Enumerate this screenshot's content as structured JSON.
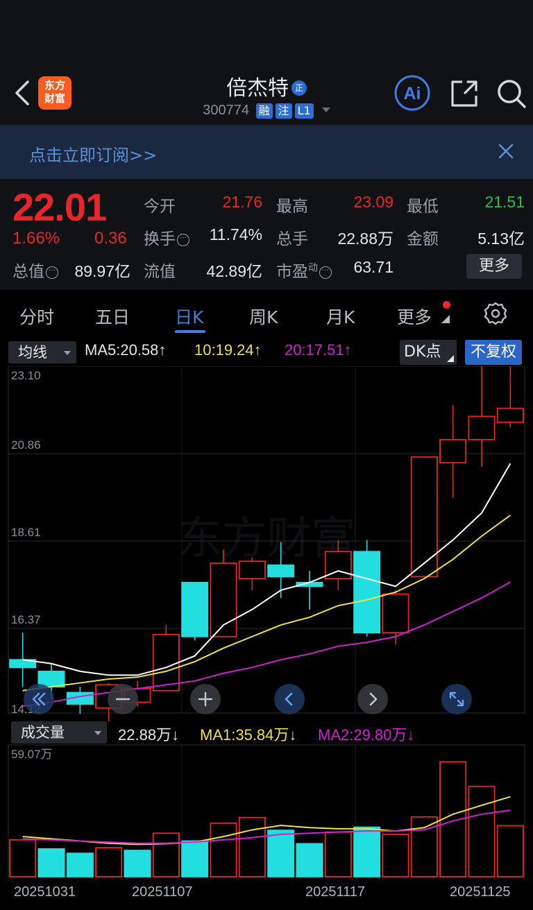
{
  "header": {
    "logo_line1": "东方",
    "logo_line2": "财富",
    "stock_name": "倍杰特",
    "zheng_badge": "正",
    "stock_code": "300774",
    "tags": [
      "融",
      "注",
      "L1"
    ],
    "ai_label": "Ai"
  },
  "banner": {
    "text": "点击立即订阅>>"
  },
  "quote": {
    "price": "22.01",
    "change_pct": "1.66%",
    "change_abs": "0.36",
    "fields": {
      "open_label": "今开",
      "open_value": "21.76",
      "high_label": "最高",
      "high_value": "23.09",
      "low_label": "最低",
      "low_value": "21.51",
      "turnover_label": "换手",
      "turnover_value": "11.74%",
      "volume_label": "总手",
      "volume_value": "22.88万",
      "amount_label": "金额",
      "amount_value": "5.13亿",
      "mktcap_label": "总值",
      "mktcap_value": "89.97亿",
      "float_label": "流值",
      "float_value": "42.89亿",
      "pe_label": "市盈",
      "pe_sup": "动",
      "pe_value": "63.71"
    },
    "more_label": "更多"
  },
  "tabs": [
    {
      "label": "分时",
      "active": false
    },
    {
      "label": "五日",
      "active": false
    },
    {
      "label": "日K",
      "active": true
    },
    {
      "label": "周K",
      "active": false
    },
    {
      "label": "月K",
      "active": false
    },
    {
      "label": "更多",
      "active": false
    }
  ],
  "ma_bar": {
    "selector": "均线",
    "ma5": "MA5:20.58↑",
    "ma10": "10:19.24↑",
    "ma20": "20:17.51↑",
    "dk_label": "DK点",
    "fq_label": "不复权"
  },
  "volume_bar": {
    "selector": "成交量",
    "vol": "22.88万↓",
    "ma1": "MA1:35.84万↓",
    "ma2": "MA2:29.80万↓"
  },
  "colors": {
    "up": "#e8262a",
    "down": "#22dede",
    "ma5": "#ffffff",
    "ma10": "#f0e040",
    "ma20": "#d020d0",
    "accent": "#3d7fe6"
  },
  "chart_data": {
    "type": "candlestick",
    "price_ticks": [
      "23.10",
      "20.86",
      "18.61",
      "16.37",
      "14.12"
    ],
    "ylim": [
      14.12,
      23.1
    ],
    "volume_max_label": "59.07万",
    "date_labels": [
      "20251031",
      "20251107",
      "20251117",
      "20251125"
    ],
    "candles": [
      {
        "o": 15.5,
        "c": 15.3,
        "h": 16.2,
        "l": 14.8
      },
      {
        "o": 15.2,
        "c": 14.8,
        "h": 15.4,
        "l": 14.5
      },
      {
        "o": 14.65,
        "c": 14.35,
        "h": 14.8,
        "l": 14.1
      },
      {
        "o": 14.25,
        "c": 14.85,
        "h": 14.9,
        "l": 13.9
      },
      {
        "o": 14.4,
        "c": 14.75,
        "h": 14.95,
        "l": 14.3
      },
      {
        "o": 14.7,
        "c": 16.15,
        "h": 16.4,
        "l": 14.7
      },
      {
        "o": 17.5,
        "c": 16.1,
        "h": 17.5,
        "l": 16.0
      },
      {
        "o": 16.1,
        "c": 18.0,
        "h": 18.35,
        "l": 16.1
      },
      {
        "o": 17.6,
        "c": 18.05,
        "h": 18.15,
        "l": 17.3
      },
      {
        "o": 17.95,
        "c": 17.65,
        "h": 18.55,
        "l": 17.1
      },
      {
        "o": 17.5,
        "c": 17.4,
        "h": 17.8,
        "l": 16.8
      },
      {
        "o": 17.6,
        "c": 18.3,
        "h": 18.6,
        "l": 17.3
      },
      {
        "o": 18.3,
        "c": 16.2,
        "h": 18.6,
        "l": 16.1
      },
      {
        "o": 16.2,
        "c": 17.2,
        "h": 17.3,
        "l": 15.9
      },
      {
        "o": 17.65,
        "c": 20.75,
        "h": 20.75,
        "l": 17.65
      },
      {
        "o": 20.6,
        "c": 21.2,
        "h": 22.1,
        "l": 19.7
      },
      {
        "o": 21.2,
        "c": 21.8,
        "h": 23.1,
        "l": 20.5
      },
      {
        "o": 21.65,
        "c": 22.01,
        "h": 23.09,
        "l": 21.51
      }
    ],
    "ma5": [
      15.5,
      15.4,
      15.2,
      15.1,
      15.1,
      15.3,
      15.6,
      16.4,
      16.8,
      17.3,
      17.5,
      17.8,
      17.6,
      17.4,
      18.0,
      18.6,
      19.3,
      20.58
    ],
    "ma10": [
      14.7,
      14.8,
      14.9,
      15.0,
      15.05,
      15.2,
      15.45,
      15.8,
      16.1,
      16.4,
      16.6,
      16.9,
      17.05,
      17.25,
      17.6,
      18.1,
      18.7,
      19.24
    ],
    "ma20": [
      14.3,
      14.4,
      14.55,
      14.65,
      14.75,
      14.85,
      14.95,
      15.15,
      15.3,
      15.5,
      15.65,
      15.85,
      15.95,
      16.1,
      16.4,
      16.75,
      17.1,
      17.51
    ],
    "volume": [
      16.5,
      12.5,
      10.5,
      13.0,
      11.8,
      19.5,
      16.0,
      24.0,
      26.5,
      20.8,
      14.8,
      20.0,
      22.2,
      19.0,
      26.8,
      51.5,
      40.5,
      22.88
    ],
    "volume_down": [
      false,
      true,
      true,
      false,
      true,
      false,
      true,
      false,
      false,
      true,
      true,
      false,
      true,
      false,
      false,
      false,
      false,
      false
    ],
    "vol_ma1": [
      18.0,
      17.0,
      16.0,
      15.0,
      14.5,
      14.8,
      15.5,
      18.0,
      21.0,
      23.0,
      22.0,
      21.5,
      21.5,
      20.5,
      22.0,
      28.0,
      32.0,
      35.84
    ],
    "vol_ma2": [
      17.0,
      16.5,
      16.0,
      15.5,
      15.0,
      15.0,
      15.5,
      16.5,
      17.5,
      19.0,
      19.5,
      20.0,
      20.5,
      20.5,
      21.0,
      25.0,
      28.0,
      29.8
    ],
    "vol_ylim": [
      0,
      59.07
    ],
    "watermark": "东方财富"
  }
}
